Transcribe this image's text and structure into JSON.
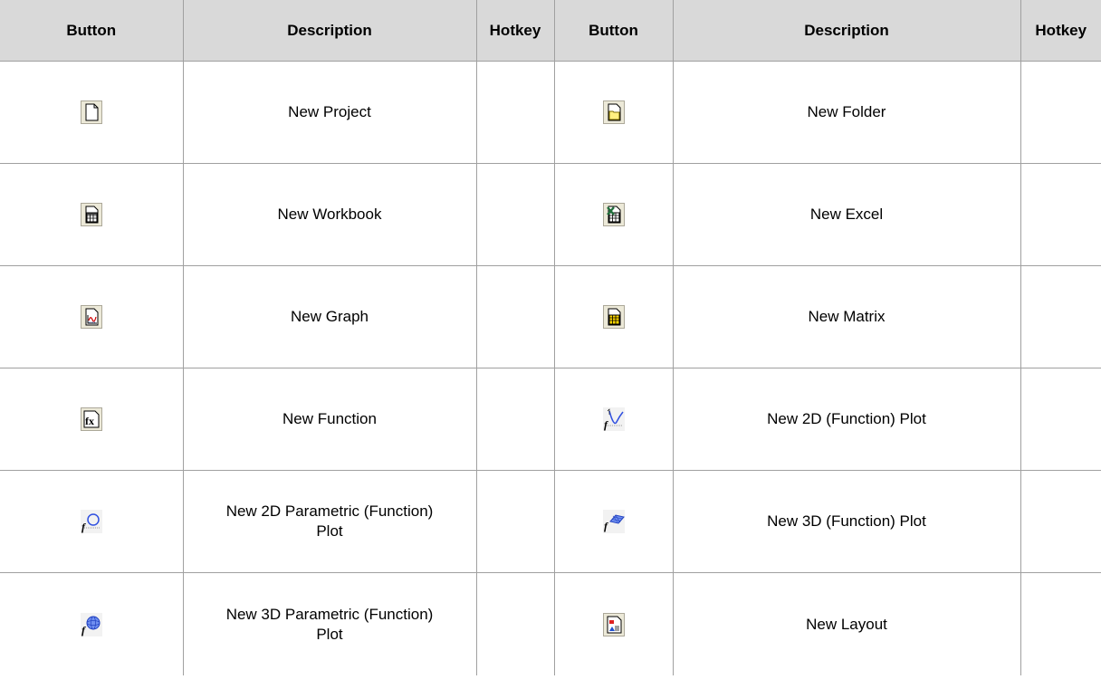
{
  "headers": [
    "Button",
    "Description",
    "Hotkey",
    "Button",
    "Description",
    "Hotkey"
  ],
  "rows": [
    {
      "left": {
        "icon": "new-project-icon",
        "desc": "New Project",
        "hotkey": ""
      },
      "right": {
        "icon": "new-folder-icon",
        "desc": "New Folder",
        "hotkey": ""
      }
    },
    {
      "left": {
        "icon": "new-workbook-icon",
        "desc": "New Workbook",
        "hotkey": ""
      },
      "right": {
        "icon": "new-excel-icon",
        "desc": "New Excel",
        "hotkey": ""
      }
    },
    {
      "left": {
        "icon": "new-graph-icon",
        "desc": "New Graph",
        "hotkey": ""
      },
      "right": {
        "icon": "new-matrix-icon",
        "desc": "New Matrix",
        "hotkey": ""
      }
    },
    {
      "left": {
        "icon": "new-function-icon",
        "desc": "New Function",
        "hotkey": ""
      },
      "right": {
        "icon": "new-2d-function-plot-icon",
        "desc": "New 2D (Function) Plot",
        "hotkey": ""
      }
    },
    {
      "left": {
        "icon": "new-2d-parametric-function-plot-icon",
        "desc": "New 2D Parametric (Function) Plot",
        "hotkey": ""
      },
      "right": {
        "icon": "new-3d-function-plot-icon",
        "desc": "New 3D (Function) Plot",
        "hotkey": ""
      }
    },
    {
      "left": {
        "icon": "new-3d-parametric-function-plot-icon",
        "desc": "New 3D Parametric (Function) Plot",
        "hotkey": ""
      },
      "right": {
        "icon": "new-layout-icon",
        "desc": "New Layout",
        "hotkey": ""
      }
    }
  ]
}
